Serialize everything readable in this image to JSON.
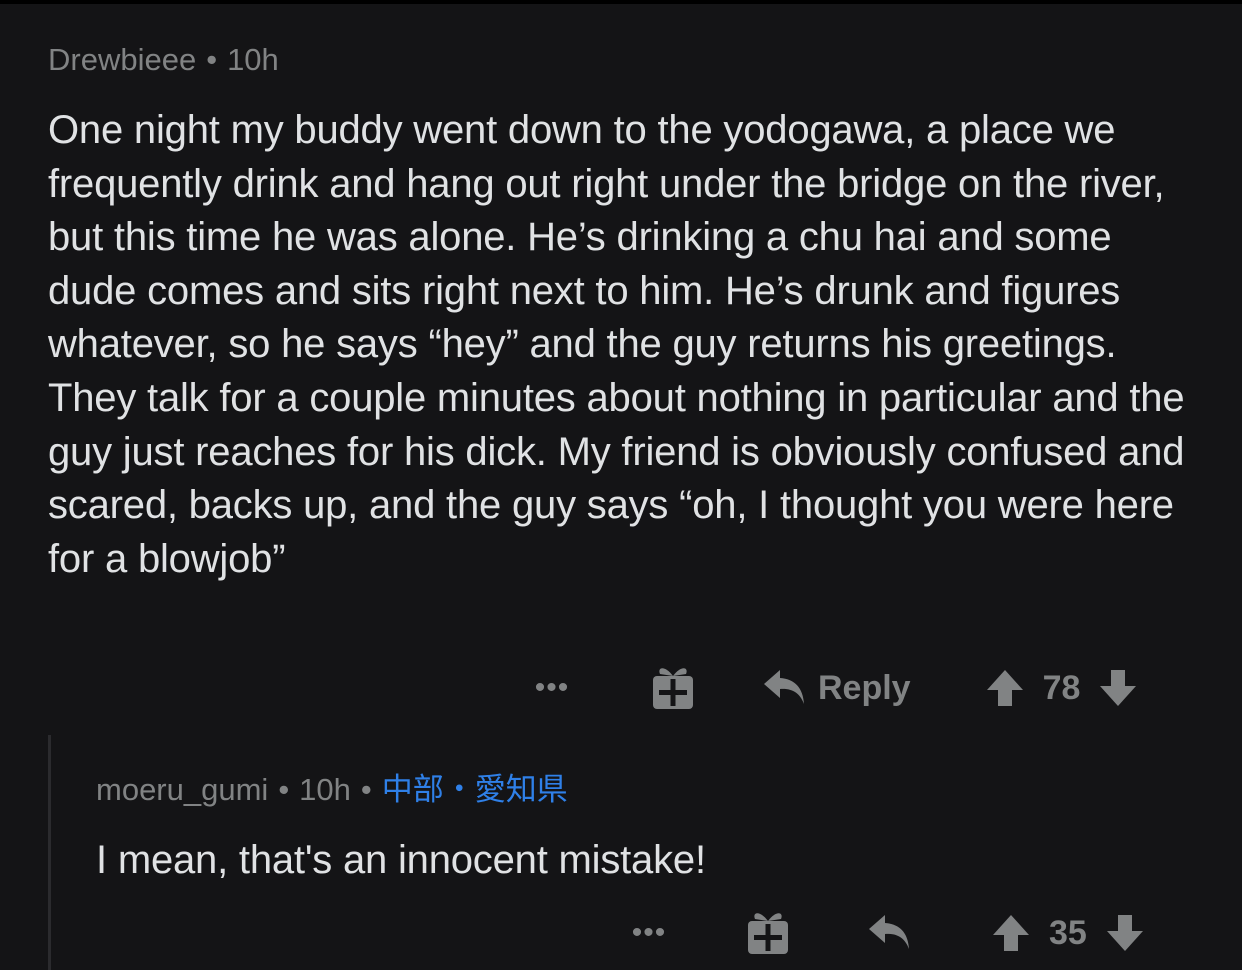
{
  "comment1": {
    "author": "Drewbieee",
    "time": "10h",
    "body": "One night my buddy went down to the yodogawa, a place we frequently drink and hang out right under the bridge on the river, but this time he was alone. He’s drinking a chu hai and some dude comes and sits right next to him. He’s drunk and figures whatever, so he says “hey” and the guy returns his greetings. They talk for a couple minutes about nothing in particular and the guy just reaches for his dick. My friend is obviously confused and scared, backs up, and the guy says “oh, I thought you were here for a blowjob”",
    "more_label": "•••",
    "reply_label": "Reply",
    "score": "78"
  },
  "comment2": {
    "author": "moeru_gumi",
    "time": "10h",
    "flair": "中部・愛知県",
    "body": "I mean, that's an innocent mistake!",
    "more_label": "•••",
    "score": "35"
  },
  "separator": "•",
  "icons": {
    "more": "more-icon",
    "award": "gift-icon",
    "reply": "reply-arrow-icon",
    "upvote": "upvote-arrow-icon",
    "downvote": "downvote-arrow-icon"
  },
  "colors": {
    "background": "#141416",
    "text": "#e0e2e4",
    "meta": "#818384",
    "flair": "#2f80e8"
  }
}
